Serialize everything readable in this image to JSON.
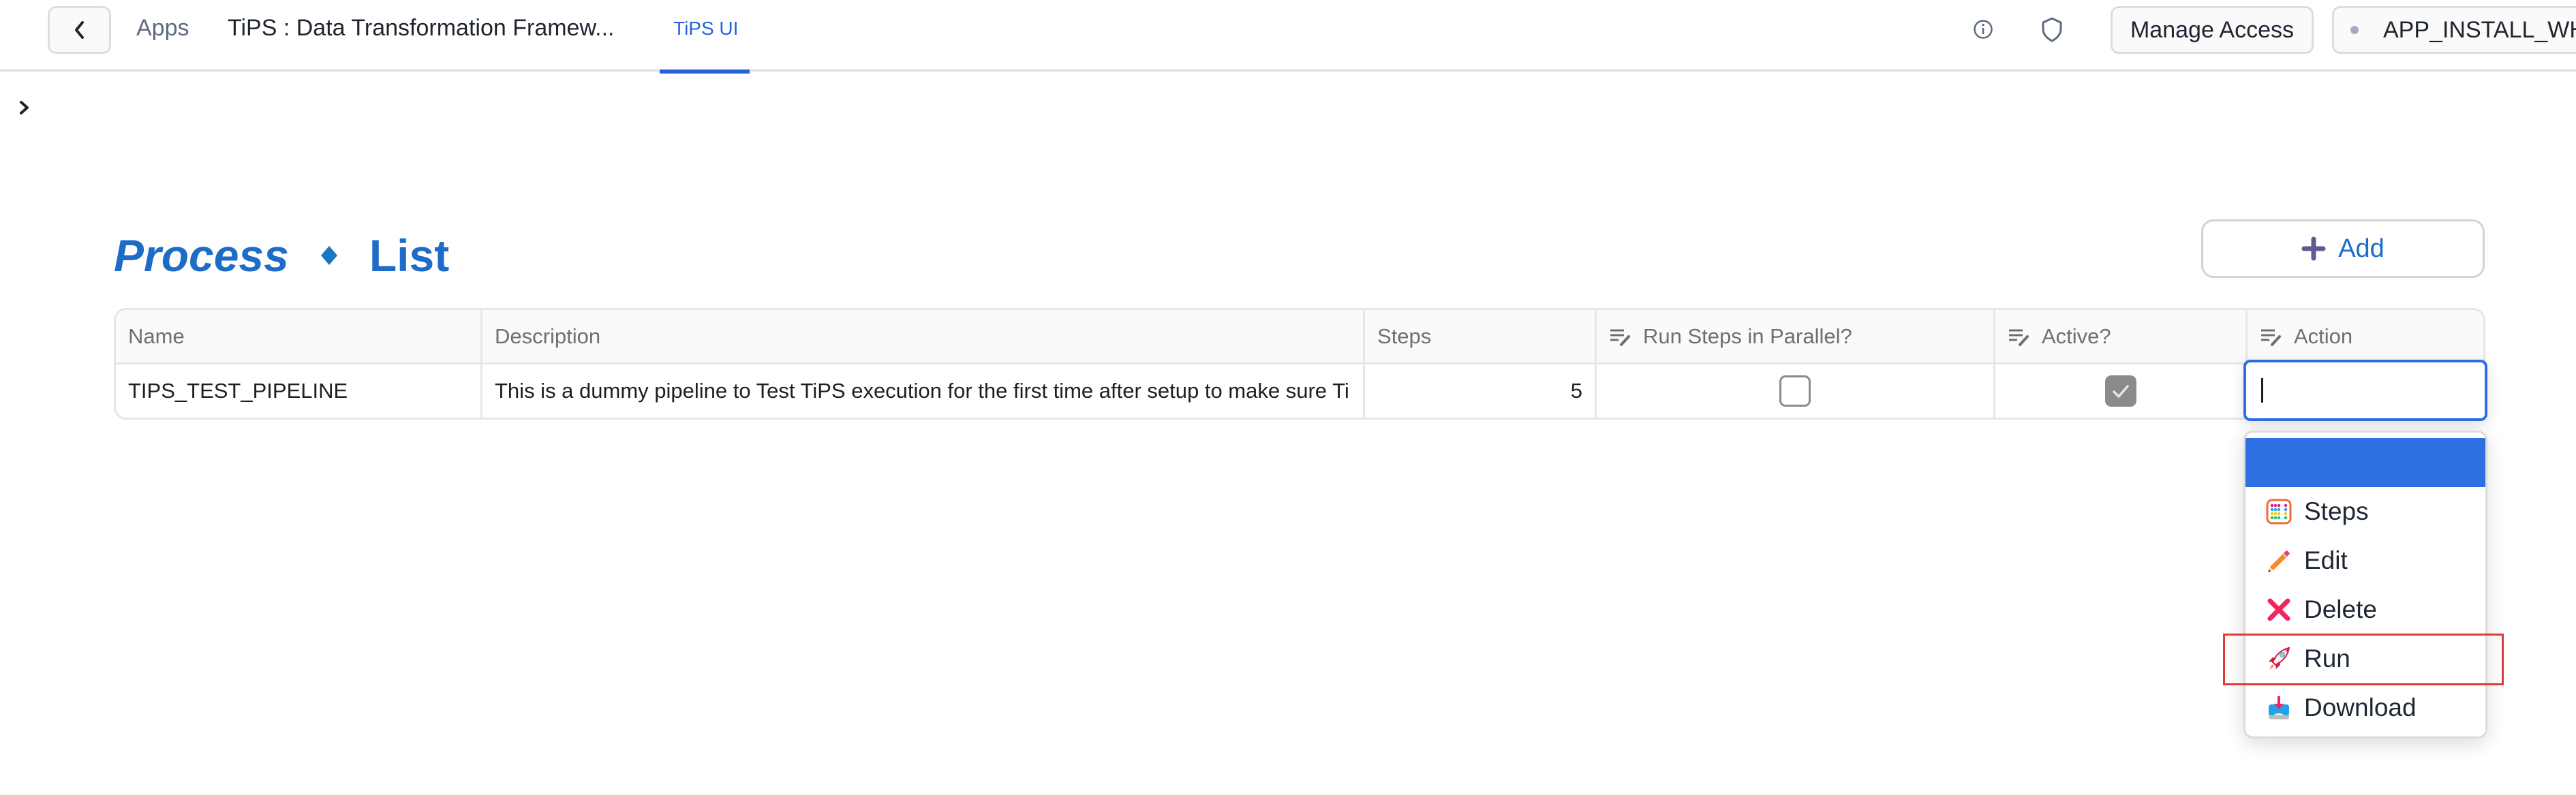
{
  "topbar": {
    "breadcrumb": {
      "apps": "Apps",
      "app_name": "TiPS : Data Transformation Framew..."
    },
    "active_tab": "TiPS UI",
    "manage_access_label": "Manage Access",
    "warehouse_label": "APP_INSTALL_WH",
    "icons": {
      "back": "chevron-left-icon",
      "info": "info-icon",
      "shield": "shield-icon",
      "warehouse_status": "status-dot"
    }
  },
  "sidebar": {
    "expand_icon": "chevron-right-icon"
  },
  "page": {
    "title_part1": "Process",
    "title_separator": "diamond",
    "title_part2": "List",
    "add_button_label": "Add"
  },
  "table": {
    "columns": [
      {
        "label": "Name",
        "editable_icon": false
      },
      {
        "label": "Description",
        "editable_icon": false
      },
      {
        "label": "Steps",
        "editable_icon": false
      },
      {
        "label": "Run Steps in Parallel?",
        "editable_icon": true
      },
      {
        "label": "Active?",
        "editable_icon": true
      },
      {
        "label": "Action",
        "editable_icon": true
      }
    ],
    "rows": [
      {
        "name": "TIPS_TEST_PIPELINE",
        "description": "This is a dummy pipeline to Test TiPS execution for the first time after setup to make sure Ti",
        "steps": "5",
        "run_steps_in_parallel": false,
        "active": true,
        "action": ""
      }
    ]
  },
  "action_editor": {
    "value": "",
    "options": [
      {
        "label": "",
        "icon": "",
        "highlighted": true
      },
      {
        "label": "Steps",
        "icon": "abacus-icon"
      },
      {
        "label": "Edit",
        "icon": "pencil-icon"
      },
      {
        "label": "Delete",
        "icon": "cross-mark-icon"
      },
      {
        "label": "Run",
        "icon": "rocket-icon",
        "annotated": true
      },
      {
        "label": "Download",
        "icon": "inbox-download-icon"
      }
    ]
  },
  "colors": {
    "accent": "#2662d9",
    "title_blue": "#1d6cc8",
    "dropdown_highlight": "#2e70e2",
    "annotation_red": "#e03a3a",
    "border": "#dadde8"
  }
}
